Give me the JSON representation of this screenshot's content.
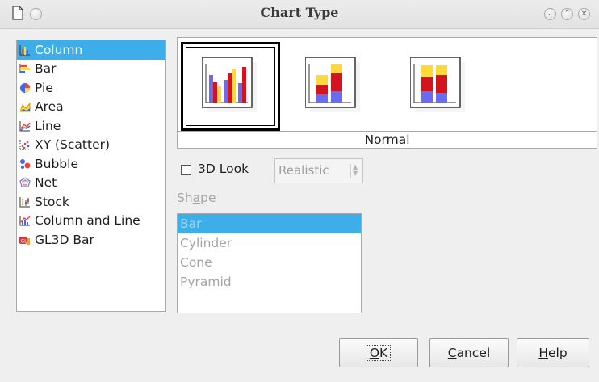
{
  "window": {
    "title": "Chart Type",
    "controls": [
      "minimize-icon",
      "maximize-icon",
      "close-icon"
    ]
  },
  "chart_types": [
    {
      "label": "Column",
      "icon": "column-chart-icon",
      "selected": true
    },
    {
      "label": "Bar",
      "icon": "bar-chart-icon",
      "selected": false
    },
    {
      "label": "Pie",
      "icon": "pie-chart-icon",
      "selected": false
    },
    {
      "label": "Area",
      "icon": "area-chart-icon",
      "selected": false
    },
    {
      "label": "Line",
      "icon": "line-chart-icon",
      "selected": false
    },
    {
      "label": "XY (Scatter)",
      "icon": "scatter-chart-icon",
      "selected": false
    },
    {
      "label": "Bubble",
      "icon": "bubble-chart-icon",
      "selected": false
    },
    {
      "label": "Net",
      "icon": "net-chart-icon",
      "selected": false
    },
    {
      "label": "Stock",
      "icon": "stock-chart-icon",
      "selected": false
    },
    {
      "label": "Column and Line",
      "icon": "column-line-chart-icon",
      "selected": false
    },
    {
      "label": "GL3D Bar",
      "icon": "gl3d-bar-chart-icon",
      "selected": false
    }
  ],
  "variants": {
    "items": [
      {
        "icon": "normal-column-icon",
        "selected": true
      },
      {
        "icon": "stacked-column-icon",
        "selected": false
      },
      {
        "icon": "percent-stacked-column-icon",
        "selected": false
      }
    ],
    "caption": "Normal"
  },
  "look_3d": {
    "label_prefix": "",
    "label_mnemonic": "3",
    "label_rest": "D Look",
    "checked": false,
    "scheme": "Realistic"
  },
  "shape": {
    "heading_pre": "Sh",
    "heading_mnemonic": "a",
    "heading_post": "pe",
    "options": [
      "Bar",
      "Cylinder",
      "Cone",
      "Pyramid"
    ],
    "selected_index": 0
  },
  "buttons": {
    "ok": {
      "mnemonic": "O",
      "rest": "K"
    },
    "cancel": {
      "mnemonic": "C",
      "rest": "ancel"
    },
    "help": {
      "mnemonic": "H",
      "rest": "elp"
    }
  },
  "colors": {
    "selection": "#3daee9",
    "series_red": "#d2141e",
    "series_yellow": "#ffd83a",
    "series_blue": "#6b6bf0"
  }
}
